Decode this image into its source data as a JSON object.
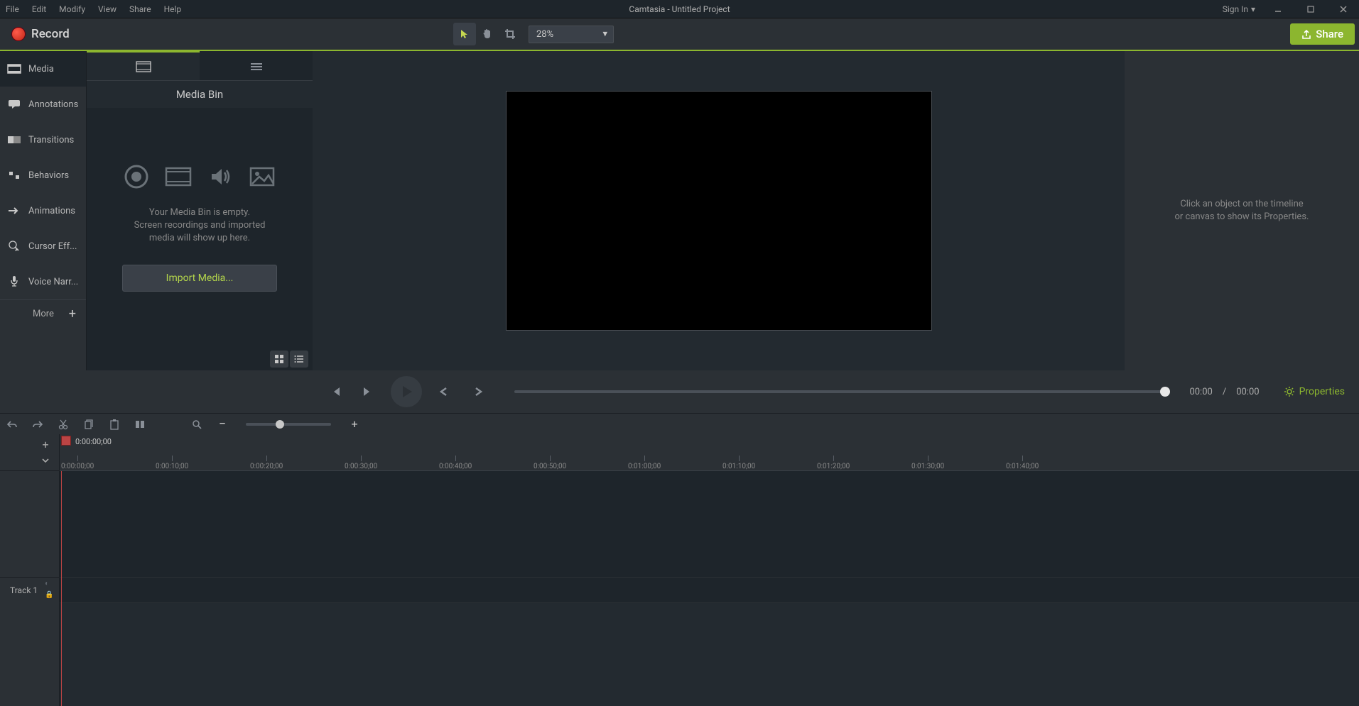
{
  "titlebar": {
    "menus": [
      "File",
      "Edit",
      "Modify",
      "View",
      "Share",
      "Help"
    ],
    "title": "Camtasia - Untitled Project",
    "signin": "Sign In"
  },
  "toolbar": {
    "record_label": "Record",
    "zoom": "28%",
    "share_label": "Share"
  },
  "sidebar": {
    "items": [
      {
        "label": "Media"
      },
      {
        "label": "Annotations"
      },
      {
        "label": "Transitions"
      },
      {
        "label": "Behaviors"
      },
      {
        "label": "Animations"
      },
      {
        "label": "Cursor Eff..."
      },
      {
        "label": "Voice Narr..."
      }
    ],
    "more": "More"
  },
  "media_bin": {
    "title": "Media Bin",
    "empty_line1": "Your Media Bin is empty.",
    "empty_line2": "Screen recordings and imported",
    "empty_line3": "media will show up here.",
    "import_label": "Import Media..."
  },
  "properties_panel": {
    "hint_line1": "Click an object on the timeline",
    "hint_line2": "or canvas to show its Properties."
  },
  "player": {
    "current": "00:00",
    "sep": "/",
    "total": "00:00",
    "properties_label": "Properties"
  },
  "timeline": {
    "playhead_time": "0:00:00;00",
    "ticks": [
      "0:00:00;00",
      "0:00:10;00",
      "0:00:20;00",
      "0:00:30;00",
      "0:00:40;00",
      "0:00:50;00",
      "0:01:00;00",
      "0:01:10;00",
      "0:01:20;00",
      "0:01:30;00",
      "0:01:40;00"
    ],
    "track1_label": "Track 1"
  }
}
